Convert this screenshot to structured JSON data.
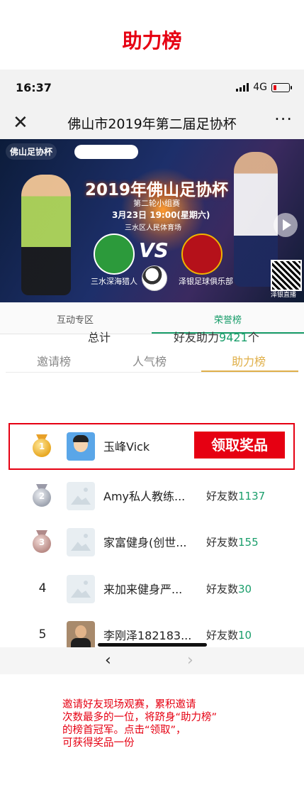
{
  "page_title": "助力榜",
  "status_bar": {
    "time": "16:37",
    "network": "4G"
  },
  "navbar": {
    "title": "佛山市2019年第二届足协杯",
    "close_icon": "close-icon",
    "more": "···"
  },
  "banner": {
    "logo_left": "佛山足协杯",
    "year_title": "2019年佛山足协杯",
    "subtitle": "第二轮小组赛",
    "date": "3月23日  19:00(星期六)",
    "venue": "三水区人民体育场",
    "vs": "VS",
    "team_left": "三水深海猎人",
    "team_right": "泽银足球俱乐部",
    "qr_label": "泽银直播"
  },
  "tabs_top": [
    {
      "label": "互动专区",
      "active": false
    },
    {
      "label": "荣誉榜",
      "active": true
    }
  ],
  "tabs_rank": [
    {
      "label": "邀请榜",
      "active": false
    },
    {
      "label": "人气榜",
      "active": false
    },
    {
      "label": "助力榜",
      "active": true
    }
  ],
  "summary": {
    "left": "总计",
    "right_prefix": "好友助力",
    "right_value": "9421",
    "right_suffix": "个"
  },
  "claim_button": "领取奖品",
  "rows": [
    {
      "rank": "1",
      "name": "玉峰Vick",
      "score_label": "",
      "score_value": ""
    },
    {
      "rank": "2",
      "name": "Amy私人教练...",
      "score_label": "好友数",
      "score_value": "1137"
    },
    {
      "rank": "3",
      "name": "家富健身(创世...",
      "score_label": "好友数",
      "score_value": "155"
    },
    {
      "rank": "4",
      "name": "来加来健身严...",
      "score_label": "好友数",
      "score_value": "30"
    },
    {
      "rank": "5",
      "name": "李刚泽182183...",
      "score_label": "好友数",
      "score_value": "10"
    }
  ],
  "bottom_nav": {
    "back": "‹",
    "forward": "›"
  },
  "caption": [
    "邀请好友现场观赛，累积邀请",
    "次数最多的一位，将跻身“助力榜”",
    "的榜首冠军。点击“领取”，",
    "可获得奖品一份"
  ],
  "colors": {
    "accent_red": "#e60012",
    "green": "#1a9e6b",
    "gold_tab": "#e0b04a"
  }
}
